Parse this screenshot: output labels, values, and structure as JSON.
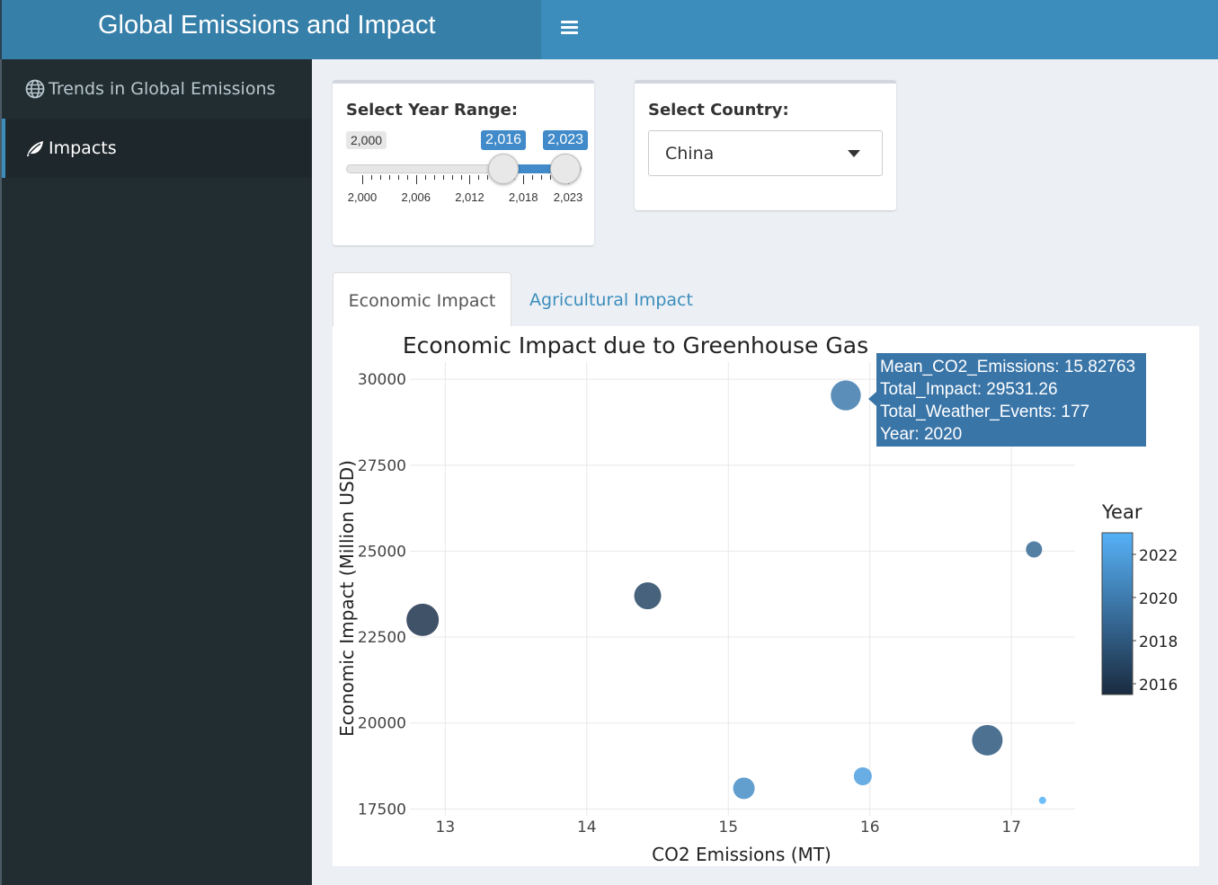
{
  "app": {
    "title": "Global Emissions and Impact"
  },
  "sidebar": {
    "items": [
      {
        "label": "Trends in Global Emissions",
        "icon": "globe-icon",
        "active": false
      },
      {
        "label": "Impacts",
        "icon": "leaf-icon",
        "active": true
      }
    ]
  },
  "filters": {
    "year_range": {
      "label": "Select Year Range:",
      "min": "2,000",
      "from": "2,016",
      "to": "2,023",
      "tick_labels": [
        "2,000",
        "2,006",
        "2,012",
        "2,018",
        "2,023"
      ]
    },
    "country": {
      "label": "Select Country:",
      "selected": "China"
    }
  },
  "tabs": [
    {
      "label": "Economic Impact",
      "active": true
    },
    {
      "label": "Agricultural Impact",
      "active": false
    }
  ],
  "tooltip": {
    "lines": [
      "Mean_CO2_Emissions: 15.82763",
      "Total_Impact: 29531.26",
      "Total_Weather_Events: 177",
      "Year: 2020"
    ]
  },
  "chart_data": {
    "type": "scatter",
    "title": "Economic Impact due to Greenhouse Gas",
    "xlabel": "CO2 Emissions (MT)",
    "ylabel": "Economic Impact (Million USD)",
    "xlim": [
      12.75,
      17.45
    ],
    "ylim": [
      17300,
      30500
    ],
    "x_ticks": [
      "13",
      "14",
      "15",
      "16",
      "17"
    ],
    "y_ticks": [
      "30000",
      "27500",
      "25000",
      "22500",
      "20000",
      "17500"
    ],
    "grid": true,
    "legend": {
      "title": "Year",
      "labels": [
        "2022",
        "2020",
        "2018",
        "2016"
      ],
      "placement": "right",
      "color_low": "#1a2b40",
      "color_high": "#56b1f7"
    },
    "points": [
      {
        "x": 12.84,
        "y": 23000,
        "year": 2016,
        "weather_events": 190
      },
      {
        "x": 14.43,
        "y": 23700,
        "year": 2017,
        "weather_events": 160
      },
      {
        "x": 16.83,
        "y": 19500,
        "year": 2018,
        "weather_events": 180
      },
      {
        "x": 17.16,
        "y": 25050,
        "year": 2019,
        "weather_events": 100
      },
      {
        "x": 15.83,
        "y": 29531.26,
        "year": 2020,
        "weather_events": 177
      },
      {
        "x": 15.11,
        "y": 18100,
        "year": 2021,
        "weather_events": 130
      },
      {
        "x": 15.95,
        "y": 18450,
        "year": 2022,
        "weather_events": 110
      },
      {
        "x": 17.22,
        "y": 17750,
        "year": 2023,
        "weather_events": 50
      }
    ]
  }
}
